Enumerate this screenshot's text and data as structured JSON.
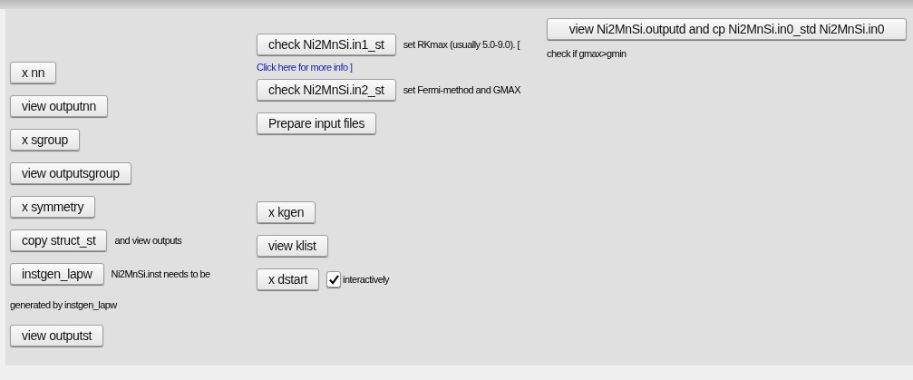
{
  "left_column": [
    {
      "kind": "button",
      "label": "x nn"
    },
    {
      "kind": "button",
      "label": "view outputnn"
    },
    {
      "kind": "button",
      "label": "x sgroup"
    },
    {
      "kind": "button",
      "label": "view outputsgroup"
    },
    {
      "kind": "button",
      "label": "x symmetry"
    },
    {
      "kind": "button",
      "label": "copy struct_st",
      "note": "and view outputs"
    },
    {
      "kind": "button",
      "label": "instgen_lapw",
      "note": "Ni2MnSi.inst needs to be"
    },
    {
      "kind": "text",
      "label": "generated by instgen_lapw"
    },
    {
      "kind": "button",
      "label": "view outputst"
    }
  ],
  "middle_column": [
    {
      "kind": "button",
      "label": "check Ni2MnSi.in1_st",
      "note": "set RKmax (usually 5.0-9.0). ["
    },
    {
      "kind": "link",
      "label": "Click here for more info ]"
    },
    {
      "kind": "button",
      "label": "check Ni2MnSi.in2_st",
      "note": "set Fermi-method and GMAX"
    },
    {
      "kind": "button",
      "label": "Prepare input files"
    },
    {
      "kind": "spacer"
    },
    {
      "kind": "button",
      "label": "x kgen"
    },
    {
      "kind": "button",
      "label": "view klist"
    },
    {
      "kind": "button",
      "label": "x dstart",
      "checkbox": {
        "checked": true,
        "label": "interactively"
      }
    }
  ],
  "right_column": [
    {
      "kind": "button",
      "label": "view Ni2MnSi.outputd and cp Ni2MnSi.in0_std Ni2MnSi.in0"
    },
    {
      "kind": "text",
      "label": "check if gmax>gmin"
    }
  ]
}
